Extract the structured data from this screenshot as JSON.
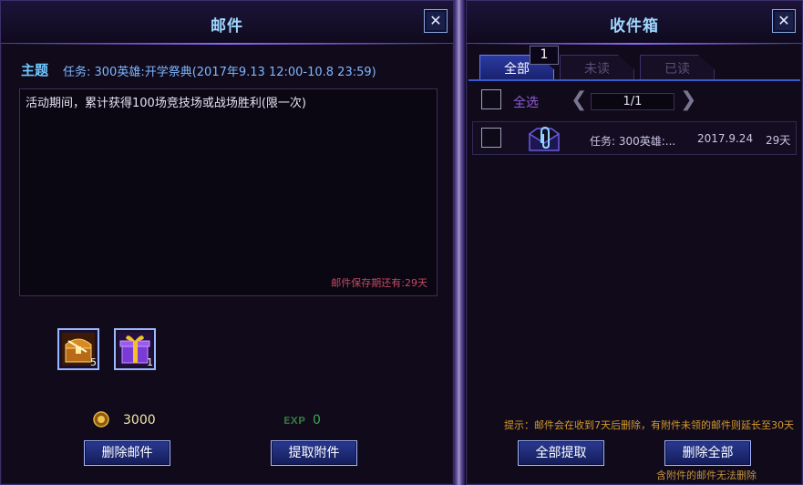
{
  "left_panel": {
    "title": "邮件",
    "close": "✕",
    "subject_label": "主题",
    "subject": "任务: 300英雄:开学祭典(2017年9.13 12:00-10.8 23:59)",
    "body": "活动期间，累计获得100场竞技场或战场胜利(限一次)",
    "retention": "邮件保存期还有:29天",
    "attachments": [
      {
        "icon": "treasure-chest-icon",
        "count": "5"
      },
      {
        "icon": "gift-box-icon",
        "count": "1"
      }
    ],
    "rewards": {
      "gold_icon": "gold-coin-icon",
      "gold": "3000",
      "exp_label": "EXP",
      "exp": "0"
    },
    "buttons": {
      "delete": "删除邮件",
      "claim": "提取附件"
    }
  },
  "right_panel": {
    "title": "收件箱",
    "close": "✕",
    "tabs": [
      {
        "label": "全部",
        "active": true
      },
      {
        "label": "未读",
        "active": false
      },
      {
        "label": "已读",
        "active": false
      }
    ],
    "tab_badge": "1",
    "select_all": "全选",
    "prev_arrow": "❮",
    "next_arrow": "❯",
    "page": "1/1",
    "mails": [
      {
        "icon": "mail-attachment-icon",
        "subject": "任务: 300英雄:...",
        "date": "2017.9.24",
        "expires": "29天"
      }
    ],
    "hint": "提示：邮件会在收到7天后删除，有附件未领的邮件则延长至30天",
    "buttons": {
      "claim_all": "全部提取",
      "delete_all": "删除全部"
    },
    "delete_note": "含附件的邮件无法删除"
  },
  "colors": {
    "accent": "#9fd8ff",
    "button": "#2a3a92",
    "warning": "#d69a2c",
    "retention": "#c24a62"
  }
}
